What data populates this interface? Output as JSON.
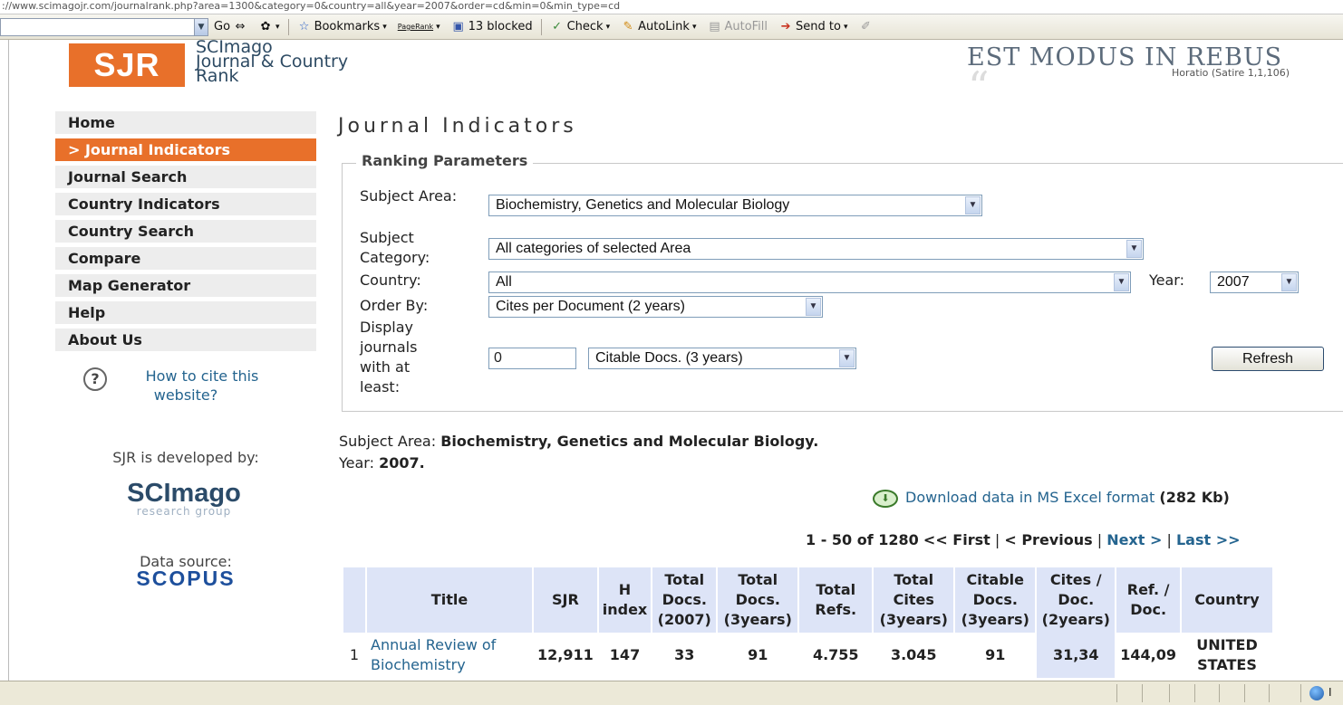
{
  "browser": {
    "url_fragment": "://www.scimagojr.com/journalrank.php?area=1300&category=0&country=all&year=2007&order=cd&min=0&min_type=cd",
    "toolbar": {
      "go_label": "Go",
      "bookmarks_label": "Bookmarks",
      "pagerank_label": "PageRank",
      "blocked_label": "13 blocked",
      "check_label": "Check",
      "autolink_label": "AutoLink",
      "autofill_label": "AutoFill",
      "sendto_label": "Send to"
    }
  },
  "header": {
    "logo_text": "SJR",
    "logo_sub": [
      "SCImago",
      "Journal & Country",
      "Rank"
    ],
    "motto": "EST MODUS IN REBUS",
    "motto_cite": "Horatio (Satire 1,1,106)",
    "brand_color": "#e8702a"
  },
  "sidebar": {
    "items": [
      {
        "label": "Home",
        "active": false
      },
      {
        "label": "> Journal Indicators",
        "active": true
      },
      {
        "label": "Journal Search",
        "active": false
      },
      {
        "label": "Country Indicators",
        "active": false
      },
      {
        "label": "Country Search",
        "active": false
      },
      {
        "label": "Compare",
        "active": false
      },
      {
        "label": "Map Generator",
        "active": false
      },
      {
        "label": "Help",
        "active": false
      },
      {
        "label": "About Us",
        "active": false
      }
    ],
    "cite_link": "How to cite this website?",
    "developed_by": "SJR is developed by:",
    "scimago_name": "SCImago",
    "scimago_tag": "research group",
    "data_source": "Data source:",
    "scopus": "SCOPUS"
  },
  "main": {
    "title": "Journal Indicators",
    "params": {
      "legend": "Ranking Parameters",
      "subject_area_label": "Subject Area:",
      "subject_area_value": "Biochemistry, Genetics and Molecular Biology",
      "subject_category_label": "Subject Category:",
      "subject_category_value": "All categories of selected Area",
      "country_label": "Country:",
      "country_value": "All",
      "year_label": "Year:",
      "year_value": "2007",
      "order_label": "Order By:",
      "order_value": "Cites per Document (2 years)",
      "display_label": "Display journals with at least:",
      "min_value": "0",
      "min_type_value": "Citable Docs. (3 years)",
      "refresh_label": "Refresh"
    },
    "summary": {
      "area_prefix": "Subject Area: ",
      "area_value": "Biochemistry, Genetics and Molecular Biology.",
      "year_prefix": "Year: ",
      "year_value": "2007."
    },
    "download": {
      "link": "Download data in MS Excel format",
      "size": "(282 Kb)"
    },
    "pager": {
      "range": "1 - 50 of 1280",
      "first": "<< First",
      "sep1": "|",
      "previous": "< Previous",
      "sep2": "|",
      "next": "Next >",
      "sep3": "|",
      "last": "Last >>"
    },
    "table": {
      "headers": [
        "Title",
        "SJR",
        "H index",
        "Total Docs. (2007)",
        "Total Docs. (3years)",
        "Total Refs.",
        "Total Cites (3years)",
        "Citable Docs. (3years)",
        "Cites / Doc. (2years)",
        "Ref. / Doc.",
        "Country"
      ],
      "rows": [
        {
          "rank": "1",
          "title": "Annual Review of Biochemistry",
          "sjr": "12,911",
          "h_index": "147",
          "docs_2007": "33",
          "docs_3y": "91",
          "refs": "4.755",
          "cites_3y": "3.045",
          "citable_3y": "91",
          "cites_per_doc": "31,34",
          "ref_per_doc": "144,09",
          "country": "UNITED STATES"
        }
      ]
    }
  }
}
